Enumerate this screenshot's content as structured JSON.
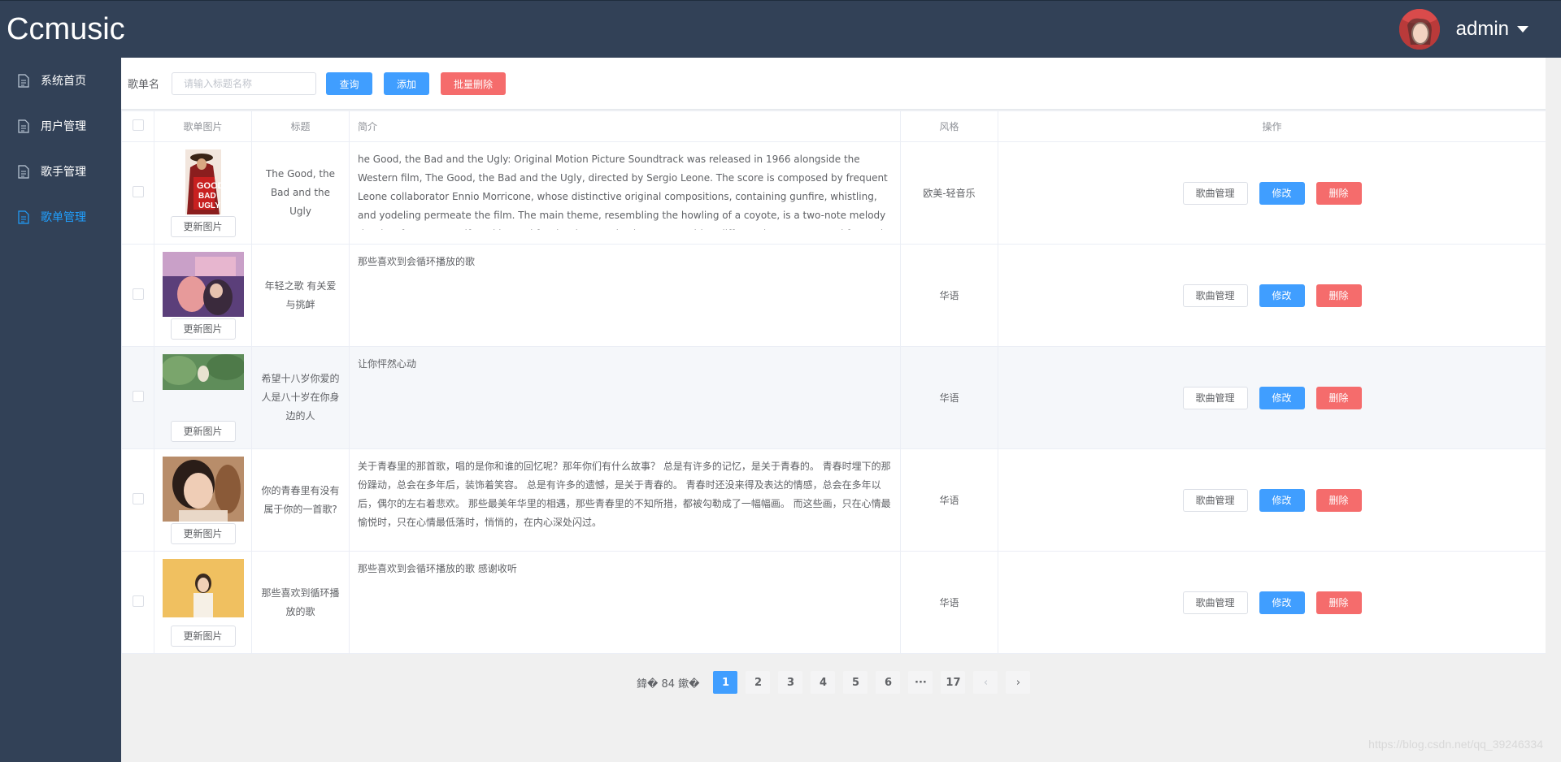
{
  "header": {
    "logo": "Ccmusic",
    "user_name": "admin"
  },
  "sidebar": {
    "items": [
      {
        "label": "系统首页",
        "icon": "document-icon",
        "active": false
      },
      {
        "label": "用户管理",
        "icon": "document-icon",
        "active": false
      },
      {
        "label": "歌手管理",
        "icon": "document-icon",
        "active": false
      },
      {
        "label": "歌单管理",
        "icon": "document-icon",
        "active": true
      }
    ]
  },
  "toolbar": {
    "search_label": "歌单名",
    "search_placeholder": "请输入标题名称",
    "query_label": "查询",
    "add_label": "添加",
    "batch_delete_label": "批量删除"
  },
  "table": {
    "headers": {
      "image": "歌单图片",
      "title": "标题",
      "intro": "简介",
      "style": "风格",
      "ops": "操作"
    },
    "update_image_label": "更新图片",
    "ops_labels": {
      "songs": "歌曲管理",
      "edit": "修改",
      "delete": "删除"
    },
    "rows": [
      {
        "title": "The Good, the Bad and the Ugly",
        "intro": "he Good, the Bad and the Ugly: Original Motion Picture Soundtrack was released in 1966 alongside the Western film, The Good, the Bad and the Ugly, directed by Sergio Leone. The score is composed by frequent Leone collaborator Ennio Morricone, whose distinctive original compositions, containing gunfire, whistling, and yodeling permeate the film. The main theme, resembling the howling of a coyote, is a two-note melody that is a frequent motif, and is used for the three main characters, with a different instrument used for each one: flute for Blondie (Man With No Name), Arghilofono (Ocarina) for Angel Eyes",
        "style": "欧美-轻音乐"
      },
      {
        "title": "年轻之歌 有关爱与挑衅",
        "intro": "那些喜欢到会循环播放的歌",
        "style": "华语"
      },
      {
        "title": "希望十八岁你爱的人是八十岁在你身边的人",
        "intro": "让你怦然心动",
        "style": "华语"
      },
      {
        "title": "你的青春里有没有属于你的一首歌?",
        "intro": "关于青春里的那首歌，唱的是你和谁的回忆呢？那年你们有什么故事？ 总是有许多的记忆，是关于青春的。 青春时埋下的那份躁动，总会在多年后，装饰着笑容。 总是有许多的遗憾，是关于青春的。 青春时还没来得及表达的情感，总会在多年以后，偶尔的左右着悲欢。 那些最美年华里的相遇，那些青春里的不知所措，都被勾勒成了一幅幅画。 而这些画，只在心情最愉悦时，只在心情最低落时，悄悄的，在内心深处闪过。",
        "style": "华语"
      },
      {
        "title": "那些喜欢到循环播放的歌",
        "intro": "那些喜欢到会循环播放的歌 感谢收听",
        "style": "华语"
      }
    ]
  },
  "pagination": {
    "total_text": "鍏� 84 鏉�",
    "pages": [
      "1",
      "2",
      "3",
      "4",
      "5",
      "6",
      "···",
      "17"
    ],
    "current": "1",
    "prev": "‹",
    "next": "›"
  },
  "watermark": "https://blog.csdn.net/qq_39246334",
  "colors": {
    "sidebar_bg": "#324157",
    "primary": "#409eff",
    "danger": "#f56c6c",
    "active_menu": "#20a0ff"
  }
}
